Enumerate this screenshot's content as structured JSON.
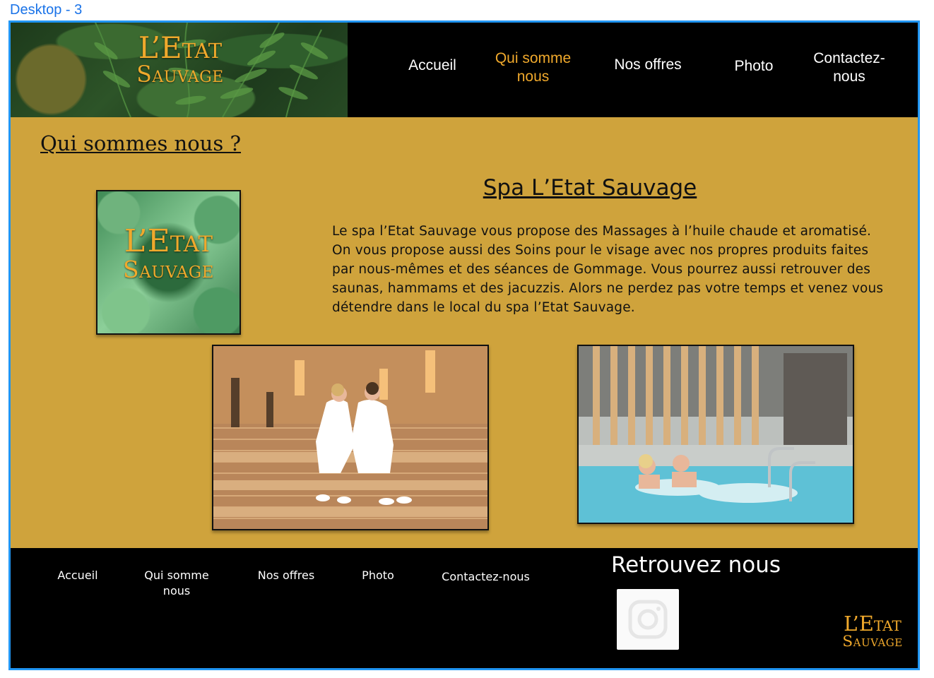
{
  "frame": {
    "label": "Desktop - 3"
  },
  "brand": {
    "line1": "L’Etat",
    "line2": "Sauvage"
  },
  "nav": {
    "items": [
      {
        "label": "Accueil",
        "active": false
      },
      {
        "label": "Qui somme nous",
        "active": true
      },
      {
        "label": "Nos offres",
        "active": false
      },
      {
        "label": "Photo",
        "active": false
      },
      {
        "label": "Contactez-nous",
        "active": false
      }
    ]
  },
  "main": {
    "section_title": "Qui sommes nous ?",
    "spa_title": "Spa L’Etat Sauvage",
    "spa_description": "Le spa l’Etat Sauvage vous propose des Massages à l’huile chaude et aromatisé. On vous propose aussi des Soins pour le visage avec nos propres produits faites par nous-mêmes et des séances de Gommage. Vous pourrez aussi retrouver des saunas, hammams et des jacuzzis. Alors ne perdez pas votre temps et venez vous détendre dans le local du spa l’Etat Sauvage."
  },
  "footer": {
    "nav": [
      "Accueil",
      "Qui somme nous",
      "Nos offres",
      "Photo",
      "Contactez-nous"
    ],
    "social_title": "Retrouvez nous",
    "social_icon": "instagram-icon"
  },
  "colors": {
    "gold": "#f0a92c",
    "background": "#cfa33c",
    "header": "#000000",
    "frame_border": "#2196f3"
  }
}
